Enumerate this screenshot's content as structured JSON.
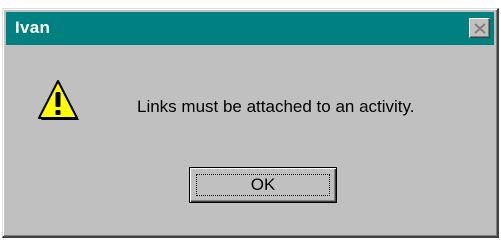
{
  "window": {
    "title": "Ivan"
  },
  "dialog": {
    "icon": "warning-icon",
    "message": "Links must be attached to an activity.",
    "ok_label": "OK"
  },
  "colors": {
    "titlebar": "#008080",
    "face": "#c0c0c0",
    "warning_fill": "#ffff00"
  }
}
